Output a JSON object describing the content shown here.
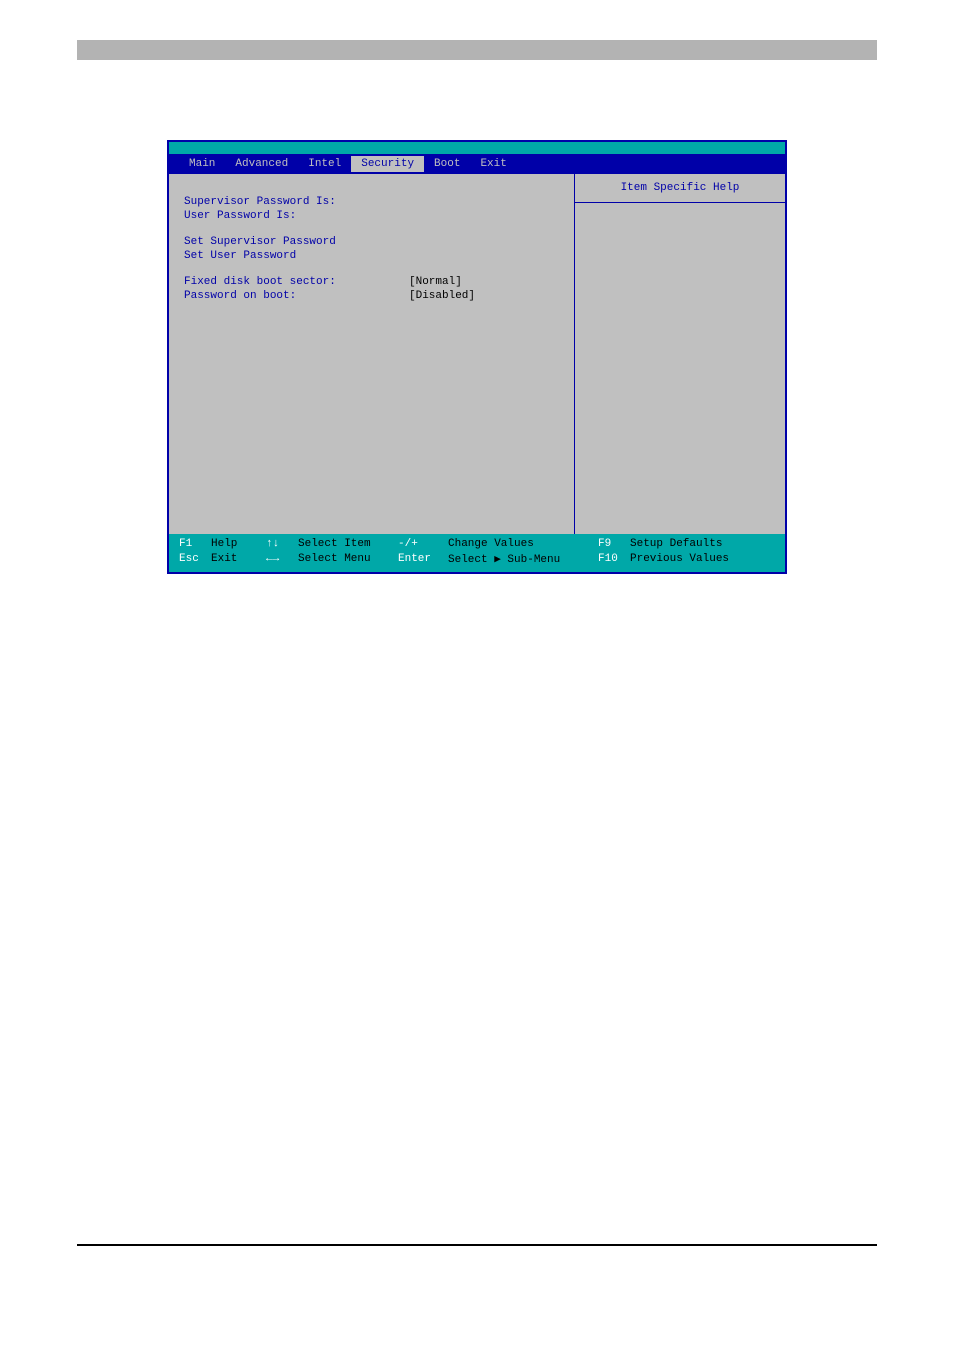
{
  "menu": {
    "items": [
      "Main",
      "Advanced",
      "Intel",
      "Security",
      "Boot",
      "Exit"
    ],
    "active_index": 3
  },
  "settings": {
    "supervisor_pw_label": "Supervisor Password Is:",
    "user_pw_label": "User Password Is:",
    "set_supervisor_label": "Set Supervisor Password",
    "set_user_label": "Set User Password",
    "fixed_disk_label": "Fixed disk boot sector:",
    "fixed_disk_value": "[Normal]",
    "password_boot_label": "Password on boot:",
    "password_boot_value": "[Disabled]"
  },
  "help": {
    "title": "Item Specific Help"
  },
  "footer": {
    "row1": {
      "k1": "F1",
      "a1": "Help",
      "k2": "↑↓",
      "a2": "Select Item",
      "k3": "-/+",
      "a3": "Change Values",
      "k4": "F9",
      "a4": "Setup Defaults"
    },
    "row2": {
      "k1": "Esc",
      "a1": "Exit",
      "k2": "←→",
      "a2": "Select Menu",
      "k3": "Enter",
      "a3": "Select ▶ Sub-Menu",
      "k4": "F10",
      "a4": "Previous Values"
    }
  }
}
